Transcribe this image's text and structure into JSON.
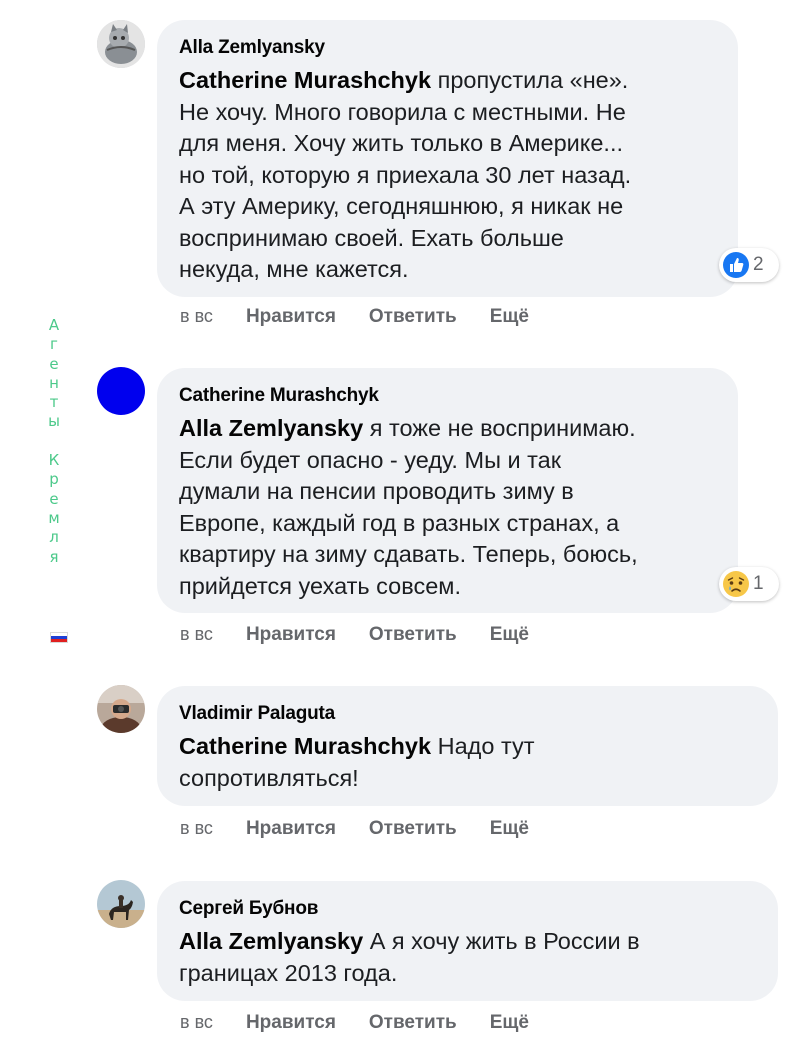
{
  "sidebar": {
    "letters": [
      "А",
      "г",
      "е",
      "н",
      "т",
      "ы",
      "",
      "К",
      "р",
      "е",
      "м",
      "л",
      "я"
    ],
    "flag_colors": [
      "#ffffff",
      "#1d3fd6",
      "#e02020"
    ]
  },
  "comments": [
    {
      "author": "Alla Zemlyansky",
      "mention": "Catherine Murashchyk",
      "lines": [
        " пропустила «не».",
        "Не хочу. Много говорила с местными. Не",
        "для меня. Хочу жить только в Америке...",
        "но той, которую я приехала 30 лет назад.",
        "А эту Америку, сегодняшнюю, я никак не",
        "воспринимаю своей. Ехать больше",
        "некуда, мне кажется."
      ],
      "reaction_icon": "like-icon",
      "reaction_count": "2",
      "time": "в вс",
      "like": "Нравится",
      "reply": "Ответить",
      "more": "Ещё"
    },
    {
      "author": "Catherine Murashchyk",
      "mention": "Alla Zemlyansky",
      "lines": [
        " я тоже не воспринимаю.",
        "Если будет опасно - уеду. Мы и так",
        "думали на пенсии проводить зиму в",
        "Европе, каждый год в разных странах, а",
        "квартиру на зиму сдавать. Теперь, боюсь,",
        "прийдется уехать совсем."
      ],
      "reaction_icon": "sad-icon",
      "reaction_count": "1",
      "avatar_color": "#0000ee",
      "time": "в вс",
      "like": "Нравится",
      "reply": "Ответить",
      "more": "Ещё"
    },
    {
      "author": "Vladimir Palaguta",
      "mention": "Catherine Murashchyk",
      "lines": [
        " Надо тут",
        "сопротивляться!"
      ],
      "time": "в вс",
      "like": "Нравится",
      "reply": "Ответить",
      "more": "Ещё"
    },
    {
      "author": "Сергей Бубнов",
      "mention": "Alla Zemlyansky",
      "lines": [
        " А я хочу жить в России в",
        "границах 2013 года."
      ],
      "time": "в вс",
      "like": "Нравится",
      "reply": "Ответить",
      "more": "Ещё"
    }
  ]
}
